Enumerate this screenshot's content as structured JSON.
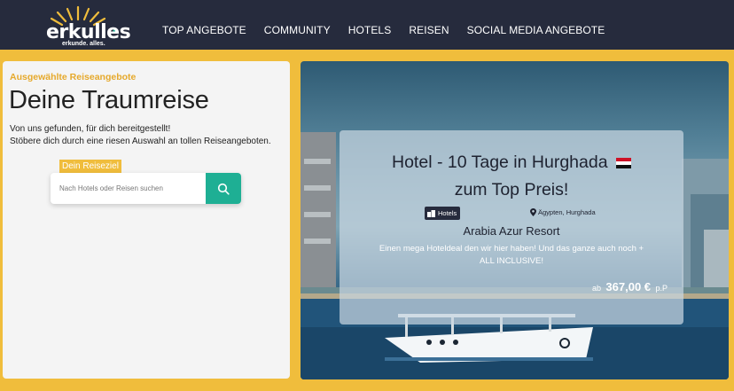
{
  "header": {
    "logo_text": "erkulles",
    "logo_tagline": "erkunde. alles.",
    "nav": [
      {
        "label": "TOP ANGEBOTE"
      },
      {
        "label": "COMMUNITY"
      },
      {
        "label": "HOTELS"
      },
      {
        "label": "REISEN"
      },
      {
        "label": "SOCIAL MEDIA ANGEBOTE"
      }
    ]
  },
  "intro": {
    "eyebrow": "Ausgewählte Reiseangebote",
    "headline": "Deine Traumreise",
    "line1": "Von uns gefunden, für dich bereitgestellt!",
    "line2": "Stöbere dich durch eine riesen Auswahl an tollen Reiseangeboten."
  },
  "search": {
    "label": "Dein Reiseziel",
    "placeholder": "Nach Hotels oder Reisen suchen",
    "button_icon": "search-icon"
  },
  "offer": {
    "title_line1": "Hotel - 10 Tage in Hurghada",
    "title_line2": "zum Top Preis!",
    "flag_icon": "egypt-flag-icon",
    "category": "Hotels",
    "location": "Ägypten, Hurghada",
    "hotel_name": "Arabia Azur Resort",
    "description": "Einen mega Hoteldeal den wir hier haben! Und das ganze auch noch + ALL INCLUSIVE!",
    "price_prefix": "ab",
    "price": "367,00 €",
    "price_suffix": "p.P"
  },
  "colors": {
    "header_bg": "#262b3d",
    "accent_yellow": "#f0bd3c",
    "search_green": "#1eaf94"
  }
}
